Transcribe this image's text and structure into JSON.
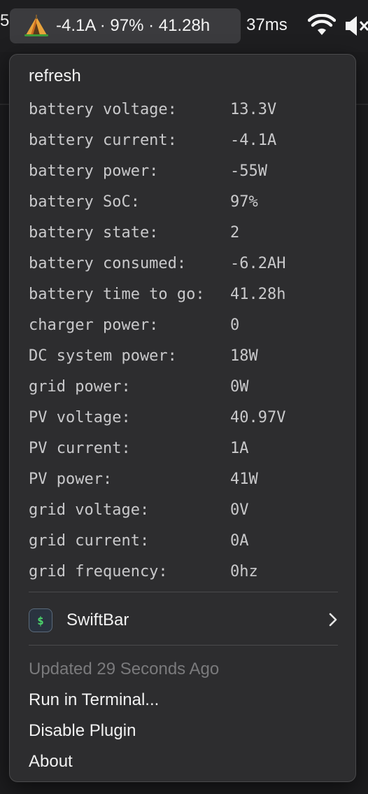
{
  "menubar": {
    "cut_item": "5",
    "status_text": "-4.1A · 97% · 41.28h",
    "ping": "37ms",
    "icons": [
      "tent-emoji-icon",
      "wifi-icon",
      "speaker-muted-icon"
    ]
  },
  "menu": {
    "refresh_label": "refresh",
    "rows": [
      {
        "label": "battery voltage:",
        "value": "13.3V"
      },
      {
        "label": "battery current:",
        "value": "-4.1A"
      },
      {
        "label": "battery power:",
        "value": "-55W"
      },
      {
        "label": "battery SoC:",
        "value": "97%"
      },
      {
        "label": "battery state:",
        "value": "2"
      },
      {
        "label": "battery consumed:",
        "value": "-6.2AH"
      },
      {
        "label": "battery time to go:",
        "value": "41.28h"
      },
      {
        "label": "charger power:",
        "value": "0"
      },
      {
        "label": "DC system power:",
        "value": "18W"
      },
      {
        "label": "grid power:",
        "value": "0W"
      },
      {
        "label": "PV voltage:",
        "value": "40.97V"
      },
      {
        "label": "PV current:",
        "value": "1A"
      },
      {
        "label": "PV power:",
        "value": "41W"
      },
      {
        "label": "grid voltage:",
        "value": "0V"
      },
      {
        "label": "grid current:",
        "value": "0A"
      },
      {
        "label": "grid frequency:",
        "value": "0hz"
      }
    ],
    "swiftbar": {
      "icon_text": "$",
      "label": "SwiftBar"
    },
    "updated_text": "Updated 29 Seconds Ago",
    "run_in_terminal": "Run in Terminal...",
    "disable_plugin": "Disable Plugin",
    "about": "About"
  }
}
